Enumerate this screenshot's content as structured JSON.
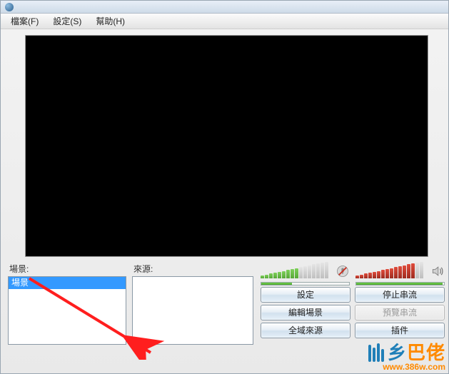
{
  "title": "",
  "menu": {
    "file": "檔案(F)",
    "settings": "設定(S)",
    "help": "幫助(H)"
  },
  "panels": {
    "scenes_label": "場景:",
    "sources_label": "來源:",
    "scene_item": "場景"
  },
  "buttons": {
    "settings": "設定",
    "stop_stream": "停止串流",
    "edit_scene": "編輯場景",
    "preview_stream": "預覽串流",
    "global_sources": "全域來源",
    "plugins": "插件"
  },
  "meters": {
    "mic": {
      "bars": 16,
      "active": 9,
      "color": "green"
    },
    "spk": {
      "bars": 16,
      "active": 14,
      "color": "red"
    }
  },
  "watermark": {
    "brand_pre": "乡",
    "brand_mid": "巴",
    "brand_post": "佬",
    "url": "www.386w.com"
  }
}
